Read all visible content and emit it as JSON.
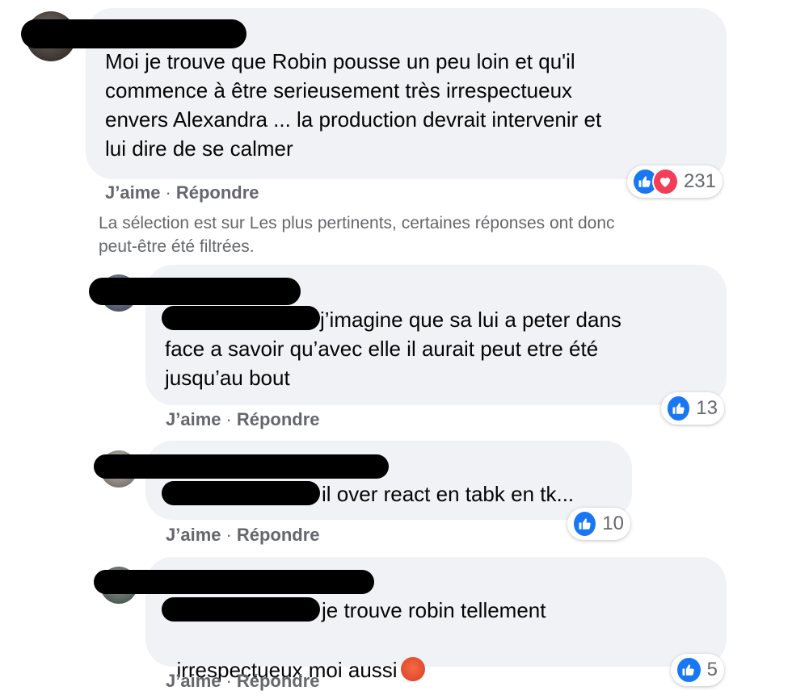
{
  "comment": {
    "text": "Moi je trouve que Robin pousse un peu loin et qu'il\ncommence à être serieusement très irrespectueux\nenvers Alexandra ... la production devrait intervenir et\nlui dire de se calmer",
    "reaction_count": "231",
    "reaction_types": [
      "like-icon",
      "love-icon"
    ],
    "like_label": "J’aime",
    "reply_label": "Répondre"
  },
  "filter_notice": "La sélection est sur Les plus pertinents, certaines réponses ont donc\npeut-être été filtrées.",
  "separator": "·",
  "replies": [
    {
      "text": "j’imagine que sa lui a peter dans\nface a savoir qu’avec elle il aurait peut etre été\njusqu’au bout",
      "reaction_count": "13",
      "like_label": "J’aime",
      "reply_label": "Répondre"
    },
    {
      "text": "il over react en tabk en tk...",
      "reaction_count": "10",
      "like_label": "J’aime",
      "reply_label": "Répondre"
    },
    {
      "text_line1": "je trouve robin tellement",
      "text_line2": "irrespectueux moi aussi",
      "emoji": "angry-face-emoji",
      "reaction_count": "5",
      "like_label": "J’aime",
      "reply_label": "Répondre"
    }
  ],
  "colors": {
    "bubble": "#f0f2f5",
    "meta_text": "#65676b",
    "like_blue": "#1877f2",
    "love_red": "#f33e58"
  }
}
